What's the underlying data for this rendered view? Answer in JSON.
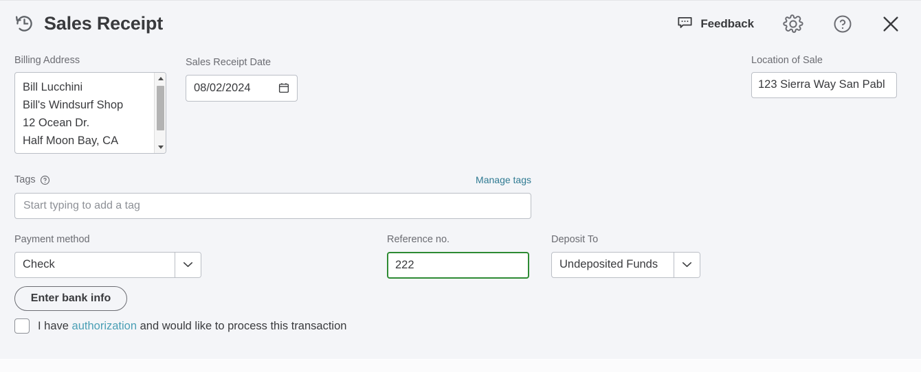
{
  "header": {
    "title": "Sales Receipt",
    "history_icon": "history-clock-icon",
    "feedback_label": "Feedback",
    "feedback_icon": "speech-bubble-icon",
    "gear_icon": "gear-icon",
    "help_icon": "question-circle-icon",
    "close_icon": "close-x-icon"
  },
  "billing": {
    "label": "Billing Address",
    "lines": [
      "Bill Lucchini",
      "Bill's Windsurf Shop",
      "12 Ocean Dr.",
      "Half Moon Bay, CA"
    ]
  },
  "date": {
    "label": "Sales Receipt Date",
    "value": "08/02/2024",
    "icon": "calendar-icon"
  },
  "location": {
    "label": "Location of Sale",
    "value": "123 Sierra Way San Pabl"
  },
  "tags": {
    "label": "Tags",
    "help_icon": "question-circle-icon",
    "manage_link": "Manage tags",
    "placeholder": "Start typing to add a tag",
    "value": ""
  },
  "payment": {
    "label": "Payment method",
    "value": "Check"
  },
  "reference": {
    "label": "Reference no.",
    "value": "222",
    "focus_color": "#2d8a33"
  },
  "deposit": {
    "label": "Deposit To",
    "value": "Undeposited Funds"
  },
  "bank_button": {
    "label": "Enter bank info"
  },
  "authorization": {
    "checked": false,
    "text_before": "I have ",
    "link_text": "authorization",
    "text_after": " and would like to process this transaction"
  },
  "colors": {
    "background": "#f4f5f8",
    "text": "#393a3d",
    "label": "#6b6c72",
    "border": "#babec5",
    "link_teal": "#2f7a92",
    "link_blue": "#4a9fb5",
    "focus_green": "#2d8a33"
  }
}
